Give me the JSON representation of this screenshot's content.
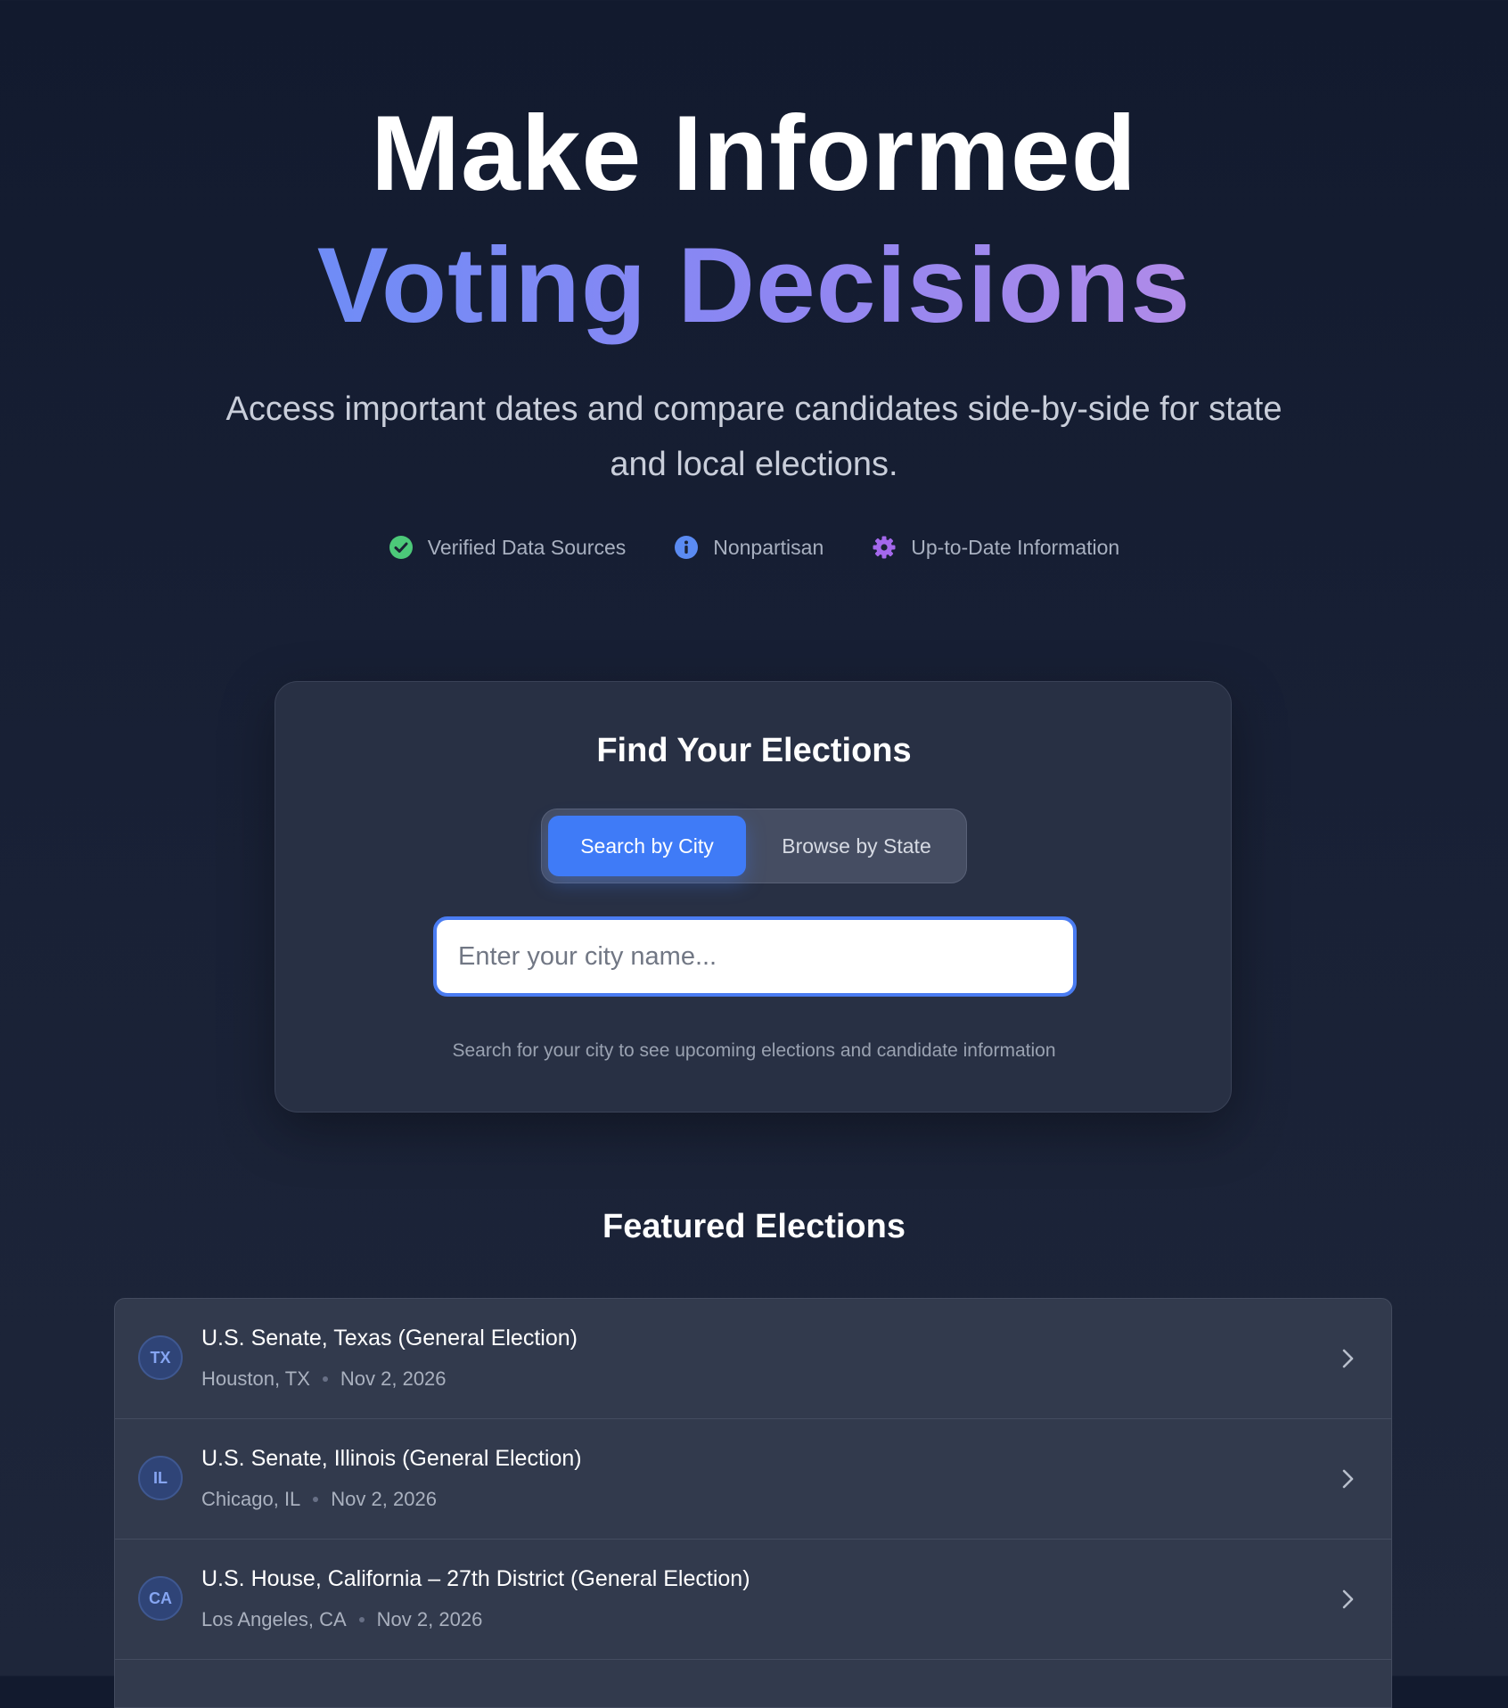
{
  "hero": {
    "title_line1": "Make Informed",
    "title_line2": "Voting Decisions",
    "subtitle": "Access important dates and compare candidates side-by-side for state and local elections."
  },
  "badges": [
    {
      "label": "Verified Data Sources",
      "icon": "check-circle-icon",
      "color": "#4cc979"
    },
    {
      "label": "Nonpartisan",
      "icon": "info-circle-icon",
      "color": "#5b8bf2"
    },
    {
      "label": "Up-to-Date Information",
      "icon": "gear-icon",
      "color": "#a468ec"
    }
  ],
  "search_card": {
    "title": "Find Your Elections",
    "tabs": [
      {
        "label": "Search by City",
        "active": true
      },
      {
        "label": "Browse by State",
        "active": false
      }
    ],
    "input": {
      "placeholder": "Enter your city name...",
      "value": ""
    },
    "helper_text": "Search for your city to see upcoming elections and candidate information"
  },
  "featured": {
    "title": "Featured Elections",
    "elections": [
      {
        "state": "TX",
        "name": "U.S. Senate, Texas (General Election)",
        "city": "Houston, TX",
        "date": "Nov 2, 2026"
      },
      {
        "state": "IL",
        "name": "U.S. Senate, Illinois (General Election)",
        "city": "Chicago, IL",
        "date": "Nov 2, 2026"
      },
      {
        "state": "CA",
        "name": "U.S. House, California – 27th District (General Election)",
        "city": "Los Angeles, CA",
        "date": "Nov 2, 2026"
      }
    ]
  },
  "colors": {
    "accent_blue": "#3f7bf7",
    "gradient_start": "#6f8cf6",
    "gradient_end": "#b08ae8",
    "background": "#141c30"
  }
}
